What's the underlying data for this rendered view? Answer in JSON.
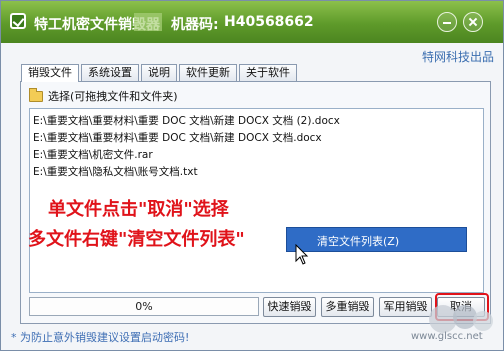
{
  "window": {
    "title": "特工机密文件销毁器",
    "code_label": "机器码:",
    "code_value": "H40568662",
    "accent_color": "#5e9a2a"
  },
  "brand_link": "特网科技出品",
  "tabs": [
    {
      "label": "销毁文件",
      "active": true
    },
    {
      "label": "系统设置",
      "active": false
    },
    {
      "label": "说明",
      "active": false
    },
    {
      "label": "软件更新",
      "active": false
    },
    {
      "label": "关于软件",
      "active": false
    }
  ],
  "panel": {
    "folder_label": "选择(可拖拽文件和文件夹)",
    "files": [
      "E:\\重要文档\\重要材料\\重要 DOC 文档\\新建 DOCX 文档 (2).docx",
      "E:\\重要文档\\重要材料\\重要 DOC 文档\\新建 DOCX 文档.docx",
      "E:\\重要文档\\机密文件.rar",
      "E:\\重要文档\\隐私文档\\账号文档.txt"
    ]
  },
  "annotations": {
    "line1": "单文件点击\"取消\"选择",
    "line2": "多文件右键\"清空文件列表\""
  },
  "context_menu": {
    "item": "清空文件列表(Z)"
  },
  "progress": {
    "value": 0,
    "text": "0%"
  },
  "buttons": {
    "quick": "快速销毁",
    "multi": "多重销毁",
    "military": "军用销毁",
    "cancel": "取消"
  },
  "tip": "* 为防止意外销毁建议设置启动密码!",
  "watermark": "www.glscc.net"
}
